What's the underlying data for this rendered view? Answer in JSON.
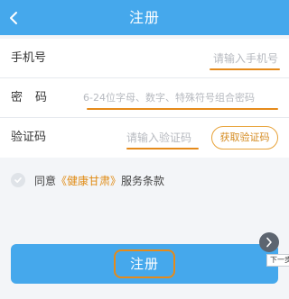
{
  "header": {
    "title": "注册",
    "back_icon": "chevron-left-icon"
  },
  "form": {
    "phone": {
      "label": "手机号",
      "placeholder": "请输入手机号",
      "value": ""
    },
    "password": {
      "label": "密码",
      "placeholder": "6-24位字母、数字、特殊符号组合密码",
      "value": ""
    },
    "code": {
      "label": "验证码",
      "placeholder": "请输入验证码",
      "value": "",
      "button_label": "获取验证码"
    }
  },
  "agreement": {
    "prefix": "同意",
    "brand": "《健康甘肃》",
    "suffix": "服务条款",
    "checked": false,
    "check_icon": "check-circle-icon"
  },
  "float_button": {
    "icon": "chevron-right-icon",
    "tooltip": "下一步"
  },
  "submit": {
    "label": "注册"
  },
  "colors": {
    "primary": "#45a8ec",
    "accent": "#e58a1a",
    "background": "#f3f5f8",
    "placeholder": "#b6b9bf"
  }
}
